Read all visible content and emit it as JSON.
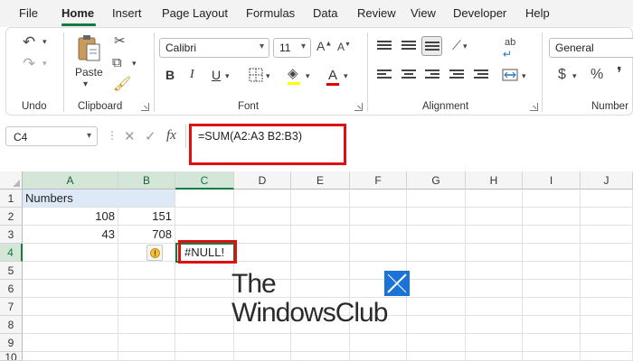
{
  "menu": {
    "items": [
      "File",
      "Home",
      "Insert",
      "Page Layout",
      "Formulas",
      "Data",
      "Review",
      "View",
      "Developer",
      "Help"
    ],
    "active": "Home"
  },
  "ribbon": {
    "undo": {
      "group": "Undo"
    },
    "clipboard": {
      "group": "Clipboard",
      "paste_label": "Paste"
    },
    "font": {
      "group": "Font",
      "family": "Calibri",
      "size": "11",
      "bold": "B",
      "italic": "I",
      "underline": "U",
      "font_color_letter": "A"
    },
    "alignment": {
      "group": "Alignment",
      "wrap_icon_text": "ab"
    },
    "number": {
      "group": "Number",
      "format": "General",
      "currency": "$",
      "percent": "%"
    }
  },
  "formula_bar": {
    "name_box": "C4",
    "fx": "fx",
    "formula": "=SUM(A2:A3 B2:B3)"
  },
  "sheet": {
    "columns": [
      "A",
      "B",
      "C",
      "D",
      "E",
      "F",
      "G",
      "H",
      "I",
      "J"
    ],
    "rows": [
      "1",
      "2",
      "3",
      "4",
      "5",
      "6",
      "7",
      "8",
      "9",
      "10"
    ],
    "cells": {
      "A1": "Numbers",
      "A2": "108",
      "B2": "151",
      "A3": "43",
      "B3": "708",
      "C4": "#NULL!"
    },
    "active_cell": "C4"
  },
  "watermark": {
    "line1": "The",
    "line2": "WindowsClub"
  },
  "colors": {
    "accent": "#107c41",
    "highlight_box": "#e01010",
    "selected_range": "#dde9f6",
    "watermark_logo": "#1a73d6"
  }
}
